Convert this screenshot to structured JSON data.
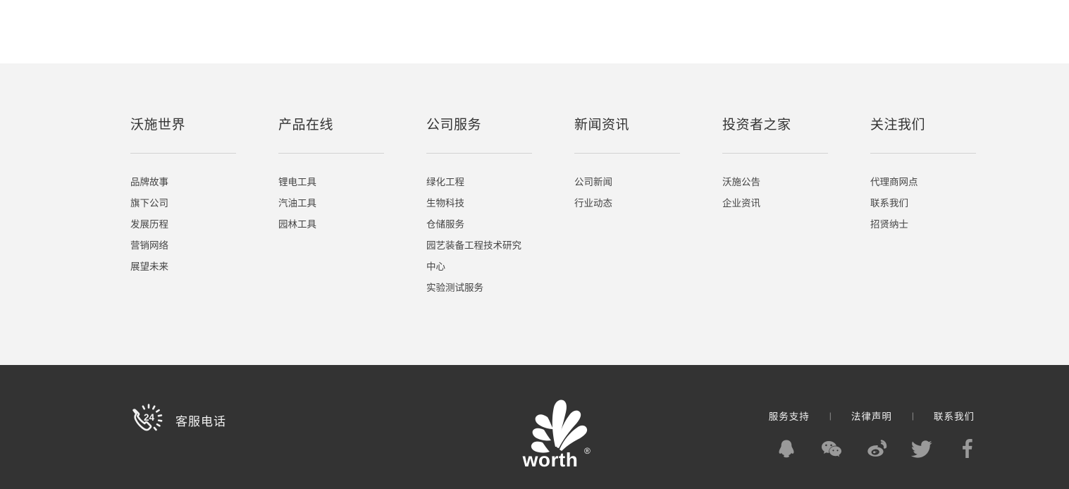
{
  "sitemap": {
    "columns": [
      {
        "title": "沃施世界",
        "links": [
          "品牌故事",
          "旗下公司",
          "发展历程",
          "营销网络",
          "展望未来"
        ]
      },
      {
        "title": "产品在线",
        "links": [
          "锂电工具",
          "汽油工具",
          "园林工具"
        ]
      },
      {
        "title": "公司服务",
        "links": [
          "绿化工程",
          "生物科技",
          "仓储服务",
          "园艺装备工程技术研究中心",
          "实验测试服务"
        ]
      },
      {
        "title": "新闻资讯",
        "links": [
          "公司新闻",
          "行业动态"
        ]
      },
      {
        "title": "投资者之家",
        "links": [
          "沃施公告",
          "企业资讯"
        ]
      },
      {
        "title": "关注我们",
        "links": [
          "代理商网点",
          "联系我们",
          "招贤纳士"
        ]
      }
    ]
  },
  "footer": {
    "hotline": {
      "icon": "phone-24h-icon",
      "badge": "24",
      "label": "客服电话"
    },
    "logo": {
      "icon": "worth-logo",
      "wordmark": "worth",
      "registered": "®"
    },
    "links": [
      "服务支持",
      "法律声明",
      "联系我们"
    ],
    "separator": "|",
    "social": [
      {
        "name": "qq-icon",
        "label": "QQ"
      },
      {
        "name": "wechat-icon",
        "label": "微信"
      },
      {
        "name": "weibo-icon",
        "label": "微博"
      },
      {
        "name": "twitter-icon",
        "label": "Twitter"
      },
      {
        "name": "facebook-icon",
        "label": "Facebook"
      }
    ]
  },
  "colors": {
    "page_white": "#ffffff",
    "sitemap_bg": "#f3f3f3",
    "footer_bg": "#333333",
    "heading": "#333333",
    "link": "#444444",
    "rule": "#d2d2d2",
    "social_icon": "#9a9a9a",
    "footer_text": "#f0f0f0"
  }
}
